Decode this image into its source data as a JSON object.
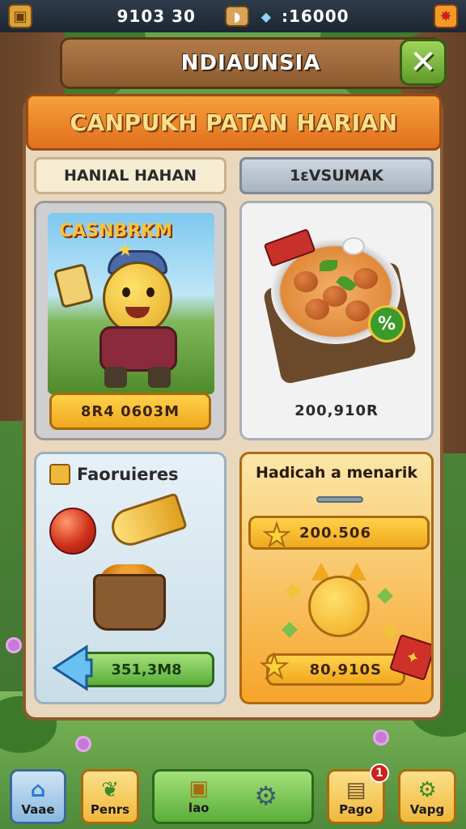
{
  "topbar": {
    "resource_1": "9103 30",
    "resource_2": ":16000"
  },
  "title": "NDIAUNSIA",
  "banner": "CANPUKH PATAN HARIAN",
  "card_a": {
    "tab": "HANIAL HAHAN",
    "logo": "CASNBRKM",
    "button": "8R4 0603M"
  },
  "card_b": {
    "tab": "1ɛVSUMAK",
    "price": "200,910R"
  },
  "card_c": {
    "title": "Faoruieres",
    "button": "351,3M8"
  },
  "card_d": {
    "title": "Hadicah a menarik",
    "button_1": "200.506",
    "button_2": "80,910S"
  },
  "nav": [
    {
      "label": "Vaae",
      "icon": "house-icon"
    },
    {
      "label": "Penrs",
      "icon": "leaf-icon"
    },
    {
      "label": "lao",
      "icon": "treasure-chest-icon"
    },
    {
      "label": "Pago",
      "icon": "backpack-icon",
      "badge": "1"
    },
    {
      "label": "Vapg",
      "icon": "gear-icon"
    }
  ],
  "colors": {
    "banner_orange": "#e0701e",
    "button_yellow": "#ffd24a",
    "button_green": "#5aae3a",
    "close_green": "#5e9a2a",
    "wood_brown": "#8c5a30"
  }
}
